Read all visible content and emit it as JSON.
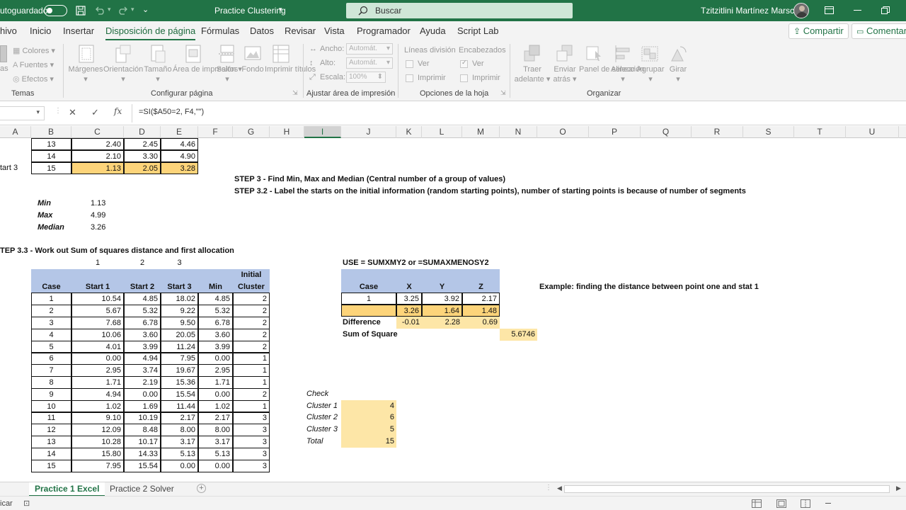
{
  "titlebar": {
    "autosave_label": "utoguardado",
    "file_name": "Practice Clustering",
    "search_placeholder": "Buscar",
    "user_name": "Tzitzitlini Martínez Marsch"
  },
  "menu": {
    "tabs": [
      "hivo",
      "Inicio",
      "Insertar",
      "Disposición de página",
      "Fórmulas",
      "Datos",
      "Revisar",
      "Vista",
      "Programador",
      "Ayuda",
      "Script Lab"
    ],
    "active_tab": "Disposición de página",
    "share_label": "Compartir",
    "comments_label": "Comentari"
  },
  "ribbon": {
    "themes": {
      "colors": "Colores",
      "fonts": "Fuentes",
      "effects": "Efectos",
      "group": "Temas"
    },
    "page_setup": {
      "margins": "Márgenes",
      "orientation": "Orientación",
      "size": "Tamaño",
      "print_area": "Área de impresión",
      "breaks": "Saltos",
      "background": "Fondo",
      "print_titles": "Imprimir títulos",
      "group": "Configurar página"
    },
    "scale": {
      "width_label": "Ancho:",
      "width_value": "Automát.",
      "height_label": "Alto:",
      "height_value": "Automát.",
      "scale_label": "Escala:",
      "scale_value": "100%",
      "group": "Ajustar área de impresión"
    },
    "sheet_options": {
      "gridlines": "Líneas división",
      "headings": "Encabezados",
      "view": "Ver",
      "print": "Imprimir",
      "group": "Opciones de la hoja"
    },
    "arrange": {
      "bring_forward": "Traer adelante",
      "send_backward": "Enviar atrás",
      "selection_pane": "Panel de selección",
      "align": "Alinear",
      "group_btn": "Agrupar",
      "rotate": "Girar",
      "group": "Organizar"
    }
  },
  "formula_bar": {
    "fx": "fx",
    "formula": "=SI($A50=2, F4,\"\")"
  },
  "columns": [
    "A",
    "B",
    "C",
    "D",
    "E",
    "F",
    "G",
    "H",
    "I",
    "J",
    "K",
    "L",
    "M",
    "N",
    "O",
    "P",
    "Q",
    "R",
    "S",
    "T",
    "U"
  ],
  "selected_column": "I",
  "top_rows": [
    {
      "label": "",
      "b": "13",
      "c": "2.40",
      "d": "2.45",
      "e": "4.46"
    },
    {
      "label": "",
      "b": "14",
      "c": "2.10",
      "d": "3.30",
      "e": "4.90"
    },
    {
      "label": "tart 3",
      "b": "15",
      "c": "1.13",
      "d": "2.05",
      "e": "3.28"
    }
  ],
  "steps": {
    "step3": "STEP 3 -  Find Min, Max and Median (Central number of a group of values)",
    "step32": "STEP 3.2 - Label the starts on the initial information (random starting points), number of starting points is because of number of segments",
    "step33": "TEP 3.3 - Work out Sum of squares distance and first allocation"
  },
  "stats": [
    {
      "label": "Min",
      "value": "1.13"
    },
    {
      "label": "Max",
      "value": "4.99"
    },
    {
      "label": "Median",
      "value": "3.26"
    }
  ],
  "table": {
    "top_numbers": [
      "1",
      "2",
      "3"
    ],
    "header_top": "Initial",
    "headers": [
      "Case",
      "Start 1",
      "Start 2",
      "Start 3",
      "Min",
      "Cluster"
    ],
    "rows": [
      [
        "1",
        "10.54",
        "4.85",
        "18.02",
        "4.85",
        "2"
      ],
      [
        "2",
        "5.67",
        "5.32",
        "9.22",
        "5.32",
        "2"
      ],
      [
        "3",
        "7.68",
        "6.78",
        "9.50",
        "6.78",
        "2"
      ],
      [
        "4",
        "10.06",
        "3.60",
        "20.05",
        "3.60",
        "2"
      ],
      [
        "5",
        "4.01",
        "3.99",
        "11.24",
        "3.99",
        "2"
      ],
      [
        "6",
        "0.00",
        "4.94",
        "7.95",
        "0.00",
        "1"
      ],
      [
        "7",
        "2.95",
        "3.74",
        "19.67",
        "2.95",
        "1"
      ],
      [
        "8",
        "1.71",
        "2.19",
        "15.36",
        "1.71",
        "1"
      ],
      [
        "9",
        "4.94",
        "0.00",
        "15.54",
        "0.00",
        "2"
      ],
      [
        "10",
        "1.02",
        "1.69",
        "11.44",
        "1.02",
        "1"
      ],
      [
        "11",
        "9.10",
        "10.19",
        "2.17",
        "2.17",
        "3"
      ],
      [
        "12",
        "12.09",
        "8.48",
        "8.00",
        "8.00",
        "3"
      ],
      [
        "13",
        "10.28",
        "10.17",
        "3.17",
        "3.17",
        "3"
      ],
      [
        "14",
        "15.80",
        "14.33",
        "5.13",
        "5.13",
        "3"
      ],
      [
        "15",
        "7.95",
        "15.54",
        "0.00",
        "0.00",
        "3"
      ]
    ]
  },
  "distance": {
    "use_text": "USE = SUMXMY2 or =SUMAXMENOSY2",
    "headers": [
      "Case",
      "X",
      "Y",
      "Z"
    ],
    "row1": [
      "1",
      "3.25",
      "3.92",
      "2.17"
    ],
    "row2": [
      "",
      "3.26",
      "1.64",
      "1.48"
    ],
    "difference_label": "Difference",
    "difference": [
      "-0.01",
      "2.28",
      "0.69"
    ],
    "sum_label": "Sum of Square",
    "sum_value": "5.6746",
    "example": "Example: finding the distance between point one and stat 1"
  },
  "check": {
    "title": "Check",
    "rows": [
      {
        "label": "Cluster 1",
        "value": "4"
      },
      {
        "label": "Cluster 2",
        "value": "6"
      },
      {
        "label": "Cluster 3",
        "value": "5"
      },
      {
        "label": "Total",
        "value": "15"
      }
    ]
  },
  "sheet_tabs": [
    "Practice 1 Excel",
    "Practice 2 Solver"
  ],
  "status": {
    "left_text": "icar"
  },
  "colors": {
    "excel_green": "#217346",
    "highlight_yellow": "#fdd47a",
    "header_blue": "#b4c6e7"
  }
}
